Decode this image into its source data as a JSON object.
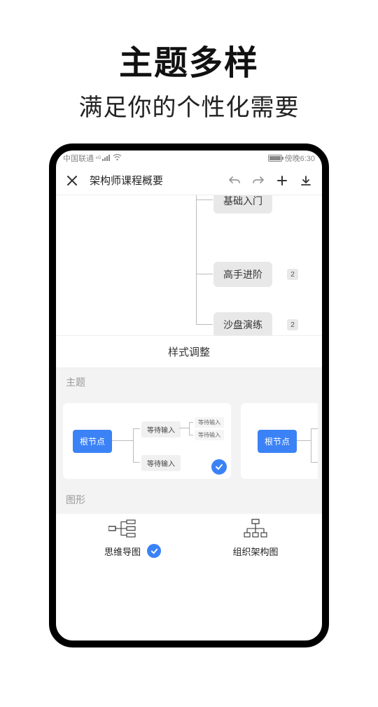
{
  "promo": {
    "title": "主题多样",
    "subtitle": "满足你的个性化需要"
  },
  "statusbar": {
    "carrier": "中国联通",
    "time": "傍晚6:30"
  },
  "header": {
    "title": "架构师课程概要"
  },
  "mindmap": {
    "nodes": [
      {
        "label": "基础入门",
        "count": null
      },
      {
        "label": "高手进阶",
        "count": "2"
      },
      {
        "label": "沙盘演练",
        "count": "2"
      }
    ]
  },
  "panel": {
    "title": "样式调整",
    "section_theme": "主题",
    "section_shape": "图形",
    "theme_cards": [
      {
        "root": "根节点",
        "child": "等待输入",
        "gchild": "等待输入",
        "selected": true
      },
      {
        "root": "根节点",
        "selected": false
      }
    ],
    "shapes": [
      {
        "label": "思维导图",
        "selected": true
      },
      {
        "label": "组织架构图",
        "selected": false
      }
    ]
  }
}
